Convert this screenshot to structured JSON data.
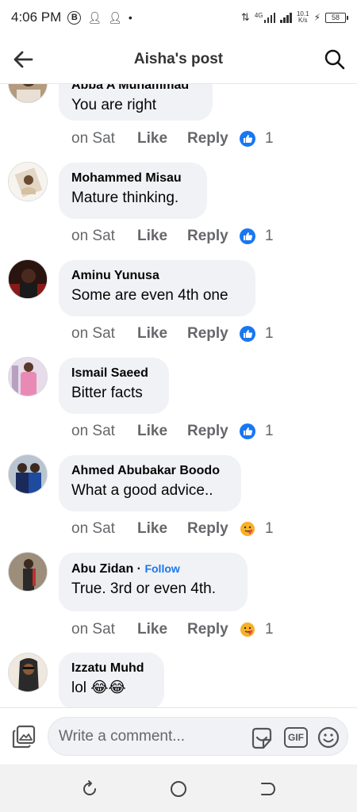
{
  "status": {
    "time": "4:06 PM",
    "badge": "B",
    "network": "4G",
    "speed_value": "10.1",
    "speed_unit": "K/s",
    "battery": "58"
  },
  "header": {
    "title": "Aisha's post"
  },
  "comments": [
    {
      "author": "Abba A Muhammad",
      "text": "You are right",
      "time": "on Sat",
      "like_label": "Like",
      "reply_label": "Reply",
      "reaction": "like",
      "reaction_count": "1"
    },
    {
      "author": "Mohammed Misau",
      "text": "Mature thinking.",
      "time": "on Sat",
      "like_label": "Like",
      "reply_label": "Reply",
      "reaction": "like",
      "reaction_count": "1"
    },
    {
      "author": "Aminu Yunusa",
      "text": "Some are even 4th one",
      "time": "on Sat",
      "like_label": "Like",
      "reply_label": "Reply",
      "reaction": "like",
      "reaction_count": "1"
    },
    {
      "author": "Ismail Saeed",
      "text": "Bitter facts",
      "time": "on Sat",
      "like_label": "Like",
      "reply_label": "Reply",
      "reaction": "like",
      "reaction_count": "1"
    },
    {
      "author": "Ahmed Abubakar Boodo",
      "text": "What a good advice..",
      "time": "on Sat",
      "like_label": "Like",
      "reply_label": "Reply",
      "reaction": "care",
      "reaction_count": "1"
    },
    {
      "author": "Abu Zidan",
      "follow_separator": "·",
      "follow_label": "Follow",
      "text": "True.  3rd or even 4th.",
      "time": "on Sat",
      "like_label": "Like",
      "reply_label": "Reply",
      "reaction": "care",
      "reaction_count": "1"
    },
    {
      "author": "Izzatu Muhd",
      "text": "lol 😂😂"
    }
  ],
  "composer": {
    "placeholder": "Write a comment...",
    "gif_label": "GIF"
  },
  "colors": {
    "accent": "#1877f2",
    "bubble": "#f0f2f5",
    "secondary_text": "#65676b",
    "care_reaction": "#f7b125"
  }
}
